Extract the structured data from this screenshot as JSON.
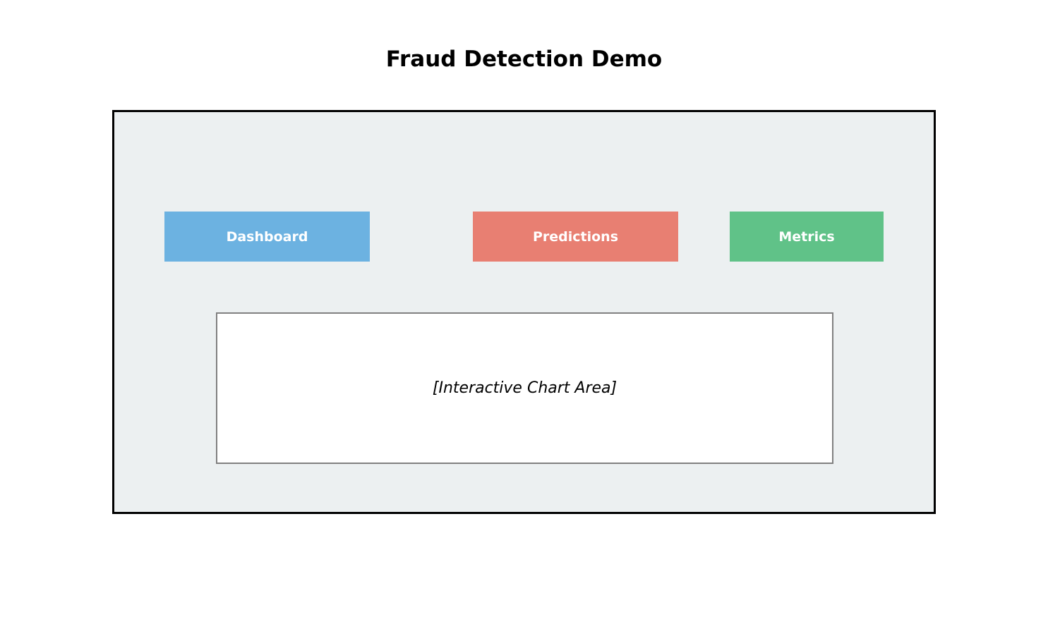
{
  "page": {
    "title": "Fraud Detection Demo"
  },
  "nav": {
    "items": [
      {
        "label": "Dashboard",
        "color": "#6cb2e1"
      },
      {
        "label": "Predictions",
        "color": "#e87f72"
      },
      {
        "label": "Metrics",
        "color": "#60c288"
      }
    ]
  },
  "main": {
    "chart_placeholder": "[Interactive Chart Area]"
  },
  "colors": {
    "frame_background": "#ecf0f1",
    "frame_border": "#000000",
    "chart_border": "#808080"
  }
}
